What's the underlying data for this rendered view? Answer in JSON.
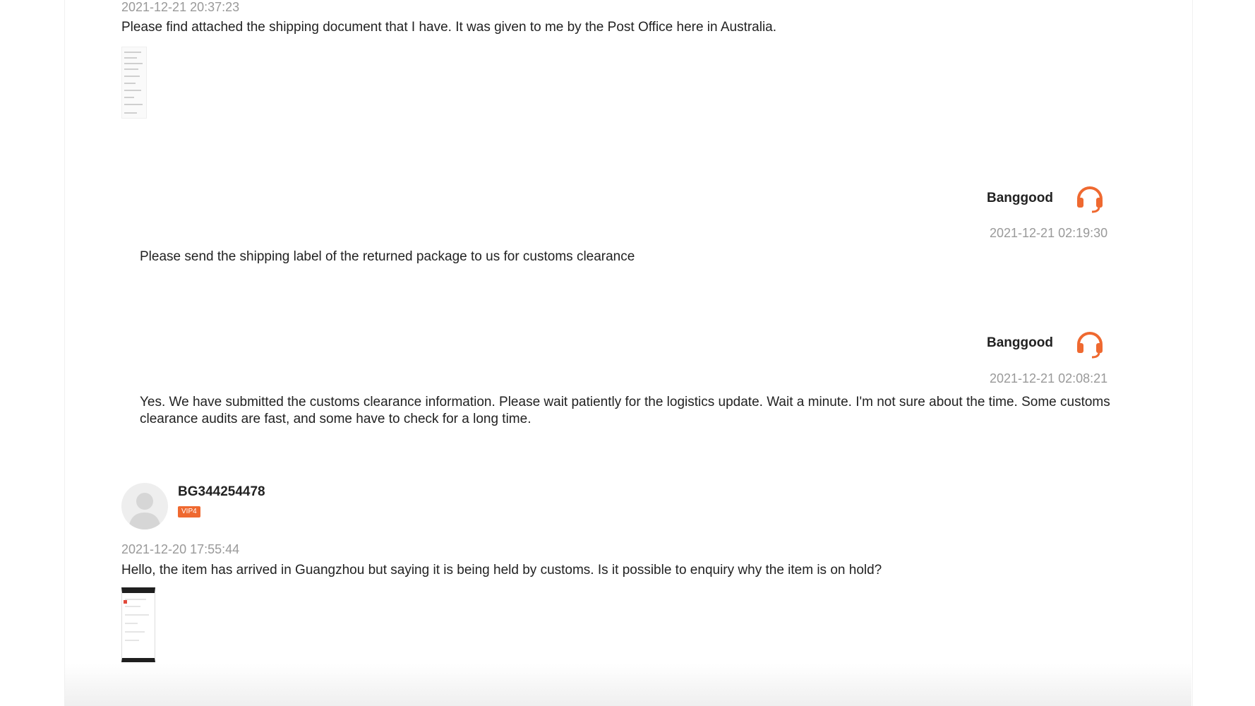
{
  "messages": [
    {
      "timestamp": "2021-12-21 20:37:23",
      "text": "Please find attached the shipping document that I have. It was given to me by the Post Office here in Australia.",
      "attachment_icon": "document-thumbnail"
    },
    {
      "sender": "Banggood",
      "avatar_icon": "headset-icon",
      "timestamp": "2021-12-21 02:19:30",
      "text": "Please send the shipping label of the returned package to us for customs clearance"
    },
    {
      "sender": "Banggood",
      "avatar_icon": "headset-icon",
      "timestamp": "2021-12-21 02:08:21",
      "text": "Yes. We have submitted the customs clearance information. Please wait patiently for the logistics update. Wait a minute. I'm not sure about the time. Some customs clearance audits are fast, and some have to check for a long time."
    },
    {
      "sender": "BG344254478",
      "badge": "VIP4",
      "avatar_icon": "default-user-avatar",
      "timestamp": "2021-12-20 17:55:44",
      "text": "Hello, the item has arrived in Guangzhou but saying it is being held by customs. Is it possible to enquiry why the item is on hold?",
      "attachment_icon": "screenshot-thumbnail"
    }
  ],
  "colors": {
    "accent": "#ef6930",
    "timestamp": "#999999",
    "text": "#222222"
  }
}
